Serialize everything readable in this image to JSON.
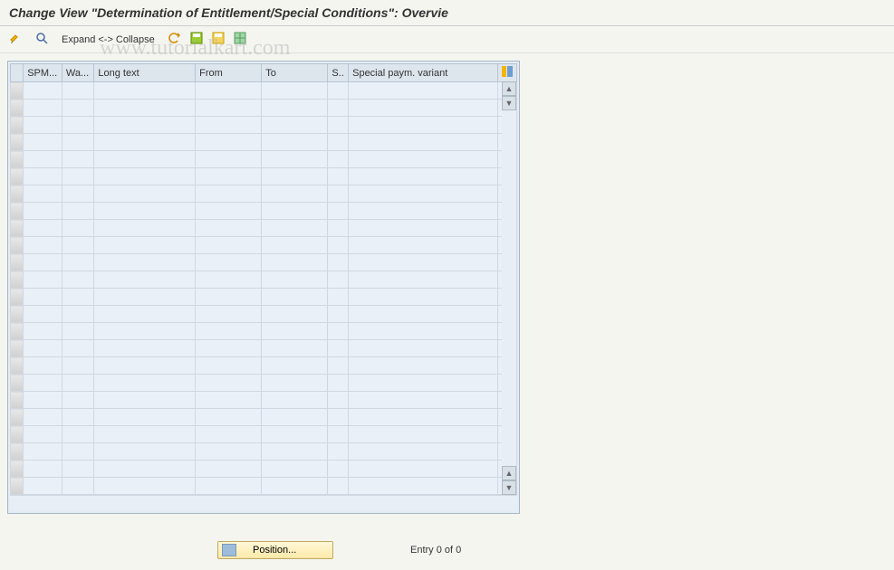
{
  "title": "Change View \"Determination of Entitlement/Special Conditions\": Overvie",
  "watermark": "www.tutorialkart.com",
  "toolbar": {
    "expand_label": "Expand <-> Collapse"
  },
  "columns": {
    "spm": "SPM...",
    "wa": "Wa...",
    "longtext": "Long text",
    "from": "From",
    "to": "To",
    "s": "S..",
    "variant": "Special paym. variant"
  },
  "footer": {
    "position_label": "Position...",
    "entry_text": "Entry 0 of 0"
  },
  "rows": 24
}
